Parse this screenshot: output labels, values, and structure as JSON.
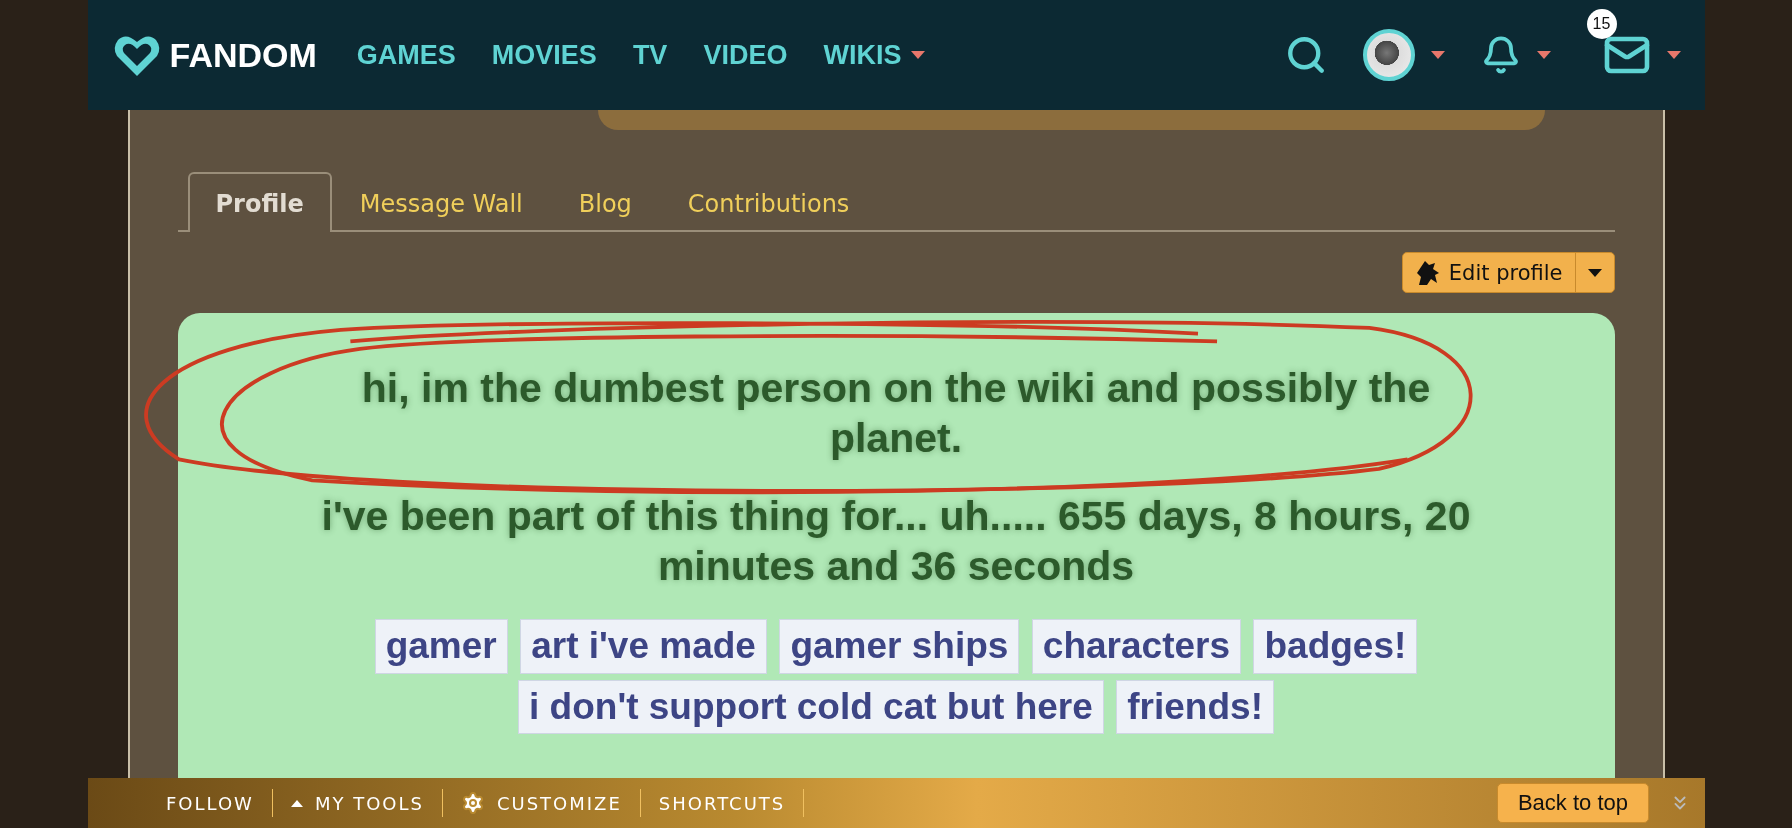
{
  "nav": {
    "logo": "FANDOM",
    "links": [
      {
        "label": "GAMES",
        "dropdown": false
      },
      {
        "label": "MOVIES",
        "dropdown": false
      },
      {
        "label": "TV",
        "dropdown": false
      },
      {
        "label": "VIDEO",
        "dropdown": false
      },
      {
        "label": "WIKIS",
        "dropdown": true
      }
    ],
    "notification_count": "15"
  },
  "tabs": [
    {
      "label": "Profile",
      "selected": true
    },
    {
      "label": "Message Wall",
      "selected": false
    },
    {
      "label": "Blog",
      "selected": false
    },
    {
      "label": "Contributions",
      "selected": false
    }
  ],
  "edit_button": {
    "label": "Edit profile"
  },
  "bio": {
    "paragraphs": [
      "hi, im the dumbest person on the wiki and possibly the planet.",
      "i've been part of this thing for... uh..... 655 days, 8 hours, 20 minutes and 36 seconds"
    ],
    "tags": [
      "gamer",
      "art i've made",
      "gamer ships",
      "characters",
      "badges!",
      "i don't support cold cat but here",
      "friends!"
    ]
  },
  "toolbar": {
    "items": [
      {
        "label": "FOLLOW",
        "kind": "text"
      },
      {
        "label": "MY TOOLS",
        "kind": "caret"
      },
      {
        "label": "CUSTOMIZE",
        "kind": "gear"
      },
      {
        "label": "SHORTCUTS",
        "kind": "text"
      }
    ],
    "back_to_top": "Back to top"
  }
}
